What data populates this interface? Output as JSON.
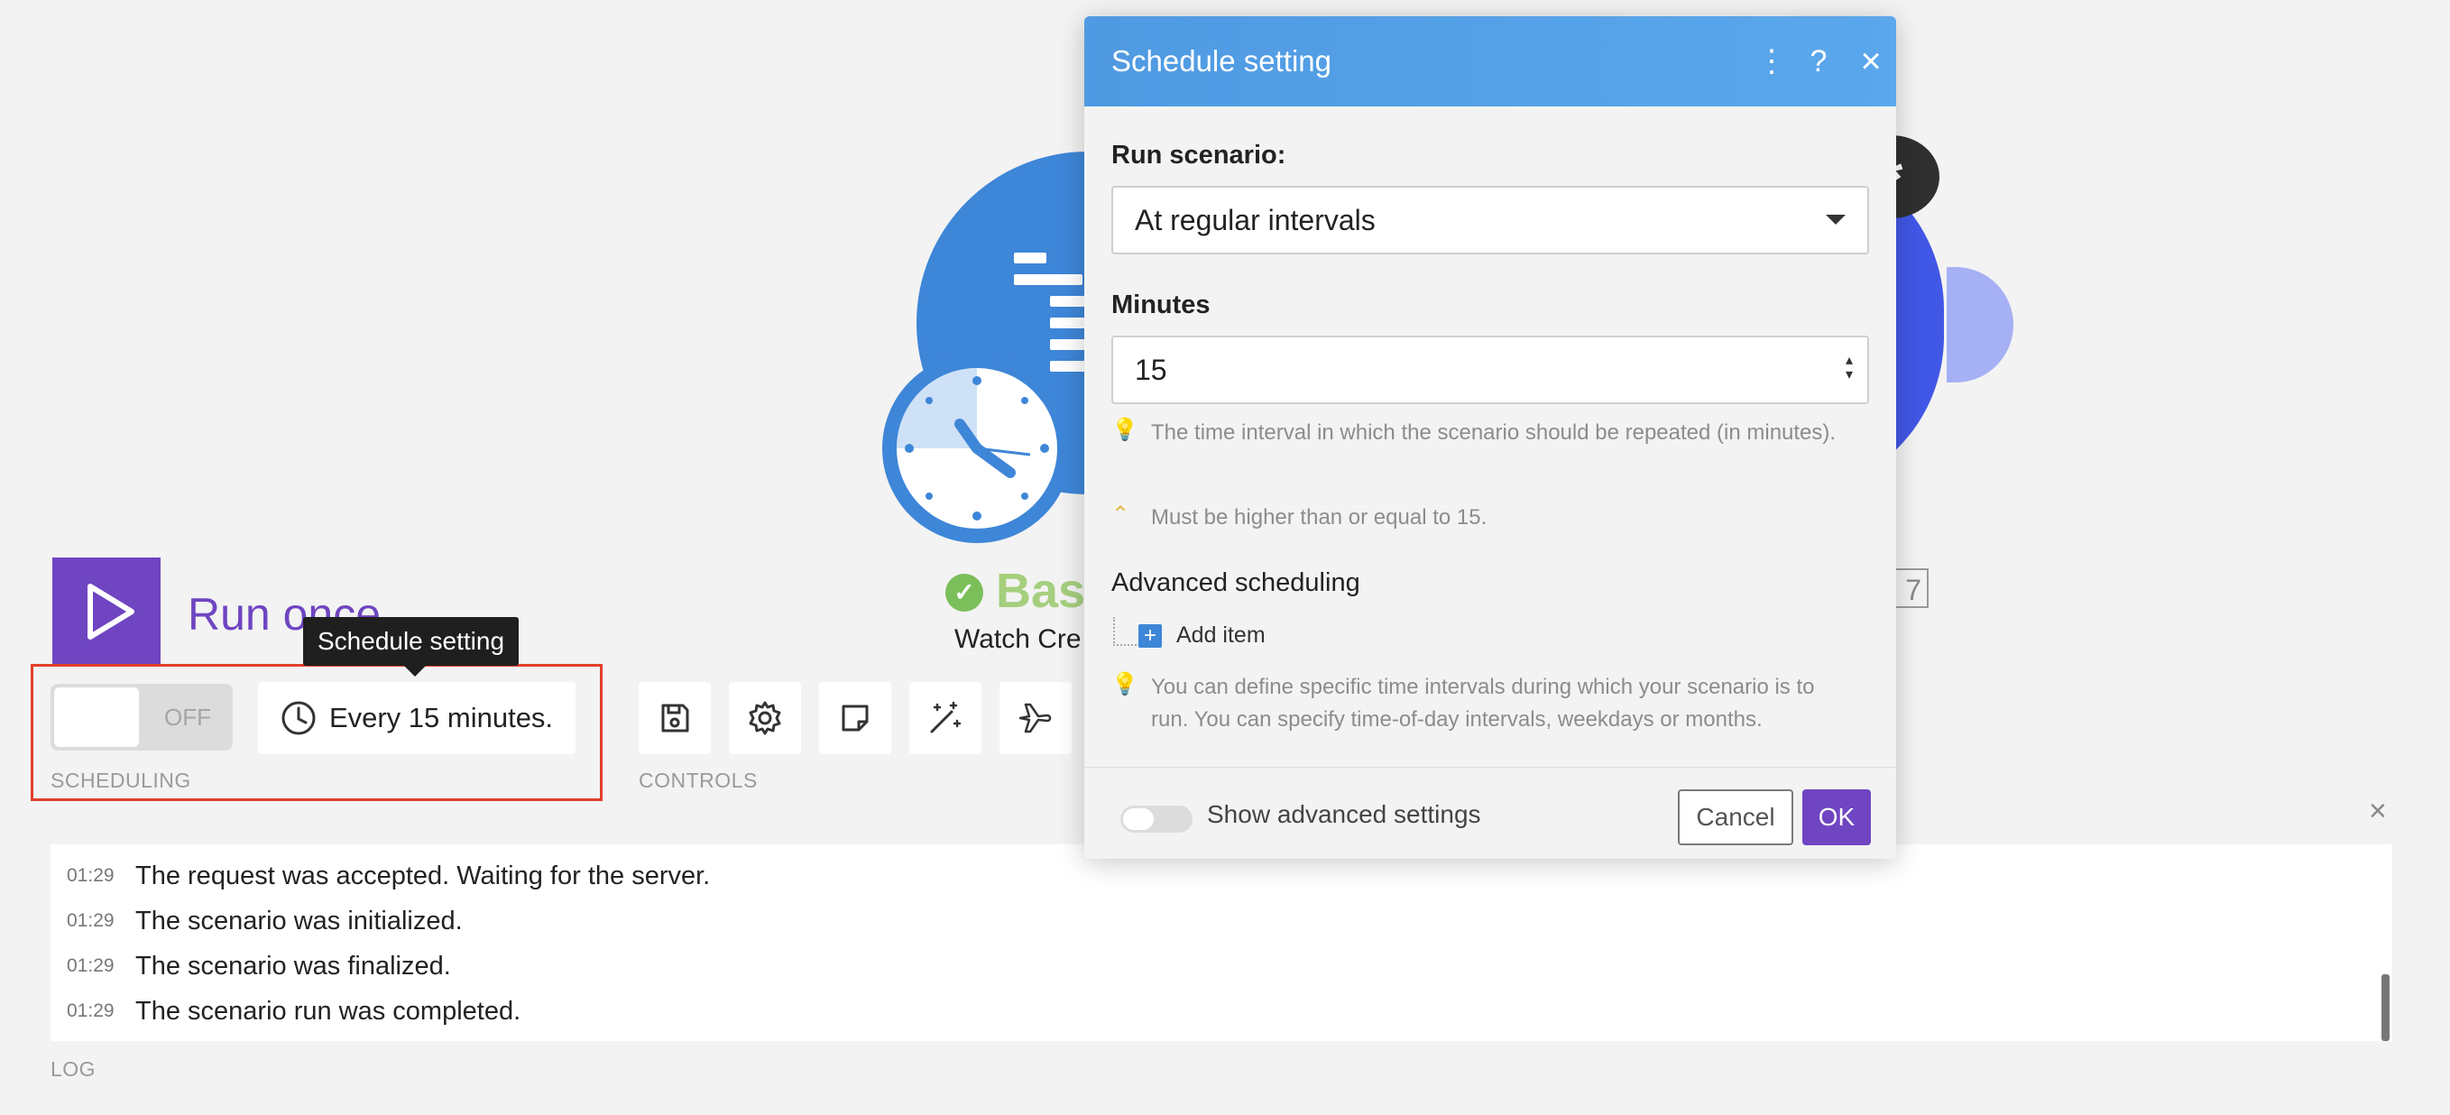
{
  "canvas": {
    "module_title": "Base",
    "module_subtitle": "Watch Cre",
    "module_badge": "7",
    "dark_node_symbol": "*"
  },
  "run": {
    "label": "Run once"
  },
  "tooltip": {
    "text": "Schedule setting"
  },
  "scheduling": {
    "toggle_label": "OFF",
    "schedule_text": "Every 15 minutes.",
    "section_label": "SCHEDULING"
  },
  "controls": {
    "section_label": "CONTROLS",
    "buttons": [
      "save-icon",
      "gear-icon",
      "note-icon",
      "magic-wand-icon",
      "airplane-icon"
    ]
  },
  "log": {
    "section_label": "LOG",
    "close_symbol": "×",
    "entries": [
      {
        "time": "01:29",
        "message": "The request was accepted. Waiting for the server."
      },
      {
        "time": "01:29",
        "message": "The scenario was initialized."
      },
      {
        "time": "01:29",
        "message": "The scenario was finalized."
      },
      {
        "time": "01:29",
        "message": "The scenario run was completed."
      }
    ]
  },
  "dialog": {
    "title": "Schedule setting",
    "icons": {
      "more": "⋮",
      "help": "?",
      "close": "×"
    },
    "run_scenario_label": "Run scenario:",
    "run_scenario_value": "At regular intervals",
    "minutes_label": "Minutes",
    "minutes_value": "15",
    "hint_interval": "The time interval in which the scenario should be repeated (in minutes).",
    "hint_min": "Must be higher than or equal to 15.",
    "advanced_title": "Advanced scheduling",
    "add_item_label": "Add item",
    "add_item_symbol": "+",
    "hint_advanced": "You can define specific time intervals during which your scenario is to run. You can specify time-of-day intervals, weekdays or months.",
    "show_advanced_label": "Show advanced settings",
    "cancel_label": "Cancel",
    "ok_label": "OK"
  },
  "colors": {
    "accent_purple": "#6f45c2",
    "header_blue": "#4f9ae2",
    "highlight_red": "#e2402b",
    "success_green": "#7bbf5a"
  }
}
